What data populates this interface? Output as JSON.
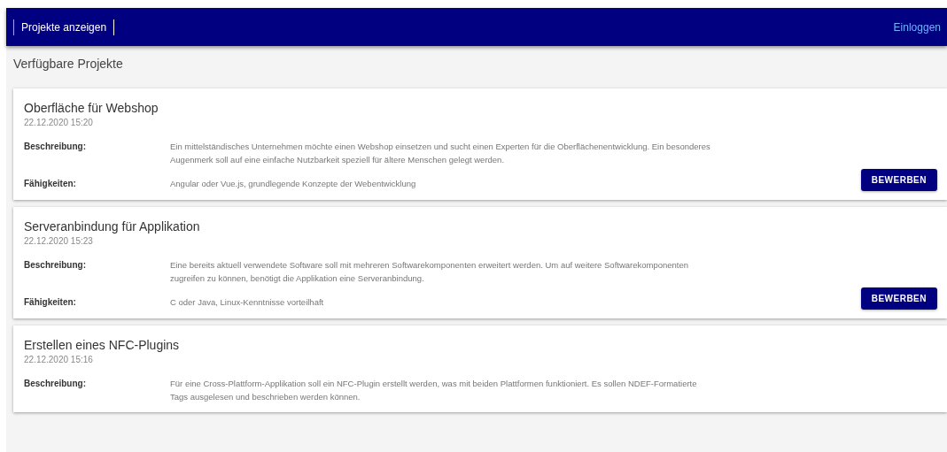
{
  "nav": {
    "link": "Projekte anzeigen",
    "login": "Einloggen"
  },
  "heading": "Verfügbare Projekte",
  "projects": [
    {
      "title": "Oberfläche für Webshop",
      "date": "22.12.2020 15:20",
      "fields": [
        {
          "label": "Beschreibung:",
          "value": "Ein mittelständisches Unternehmen möchte einen Webshop einsetzen und sucht einen Experten für die Oberflächenentwicklung. Ein besonderes Augenmerk soll auf eine einfache Nutzbarkeit speziell für ältere Menschen gelegt werden."
        },
        {
          "label": "Fähigkeiten:",
          "value": "Angular oder Vue.js, grundlegende Konzepte der Webentwicklung"
        }
      ],
      "button": "BEWERBEN"
    },
    {
      "title": "Serveranbindung für Applikation",
      "date": "22.12.2020 15:23",
      "fields": [
        {
          "label": "Beschreibung:",
          "value": "Eine bereits aktuell verwendete Software soll mit mehreren Softwarekomponenten erweitert werden. Um auf weitere Softwarekomponenten zugreifen zu können, benötigt die Applikation eine Serveranbindung."
        },
        {
          "label": "Fähigkeiten:",
          "value": "C oder Java, Linux-Kenntnisse vorteilhaft"
        }
      ],
      "button": "BEWERBEN"
    },
    {
      "title": "Erstellen eines NFC-Plugins",
      "date": "22.12.2020 15:16",
      "fields": [
        {
          "label": "Beschreibung:",
          "value": "Für eine Cross-Plattform-Applikation soll ein NFC-Plugin erstellt werden, was mit beiden Plattformen funktioniert. Es sollen NDEF-Formatierte Tags ausgelesen und beschrieben werden können."
        }
      ]
    }
  ]
}
